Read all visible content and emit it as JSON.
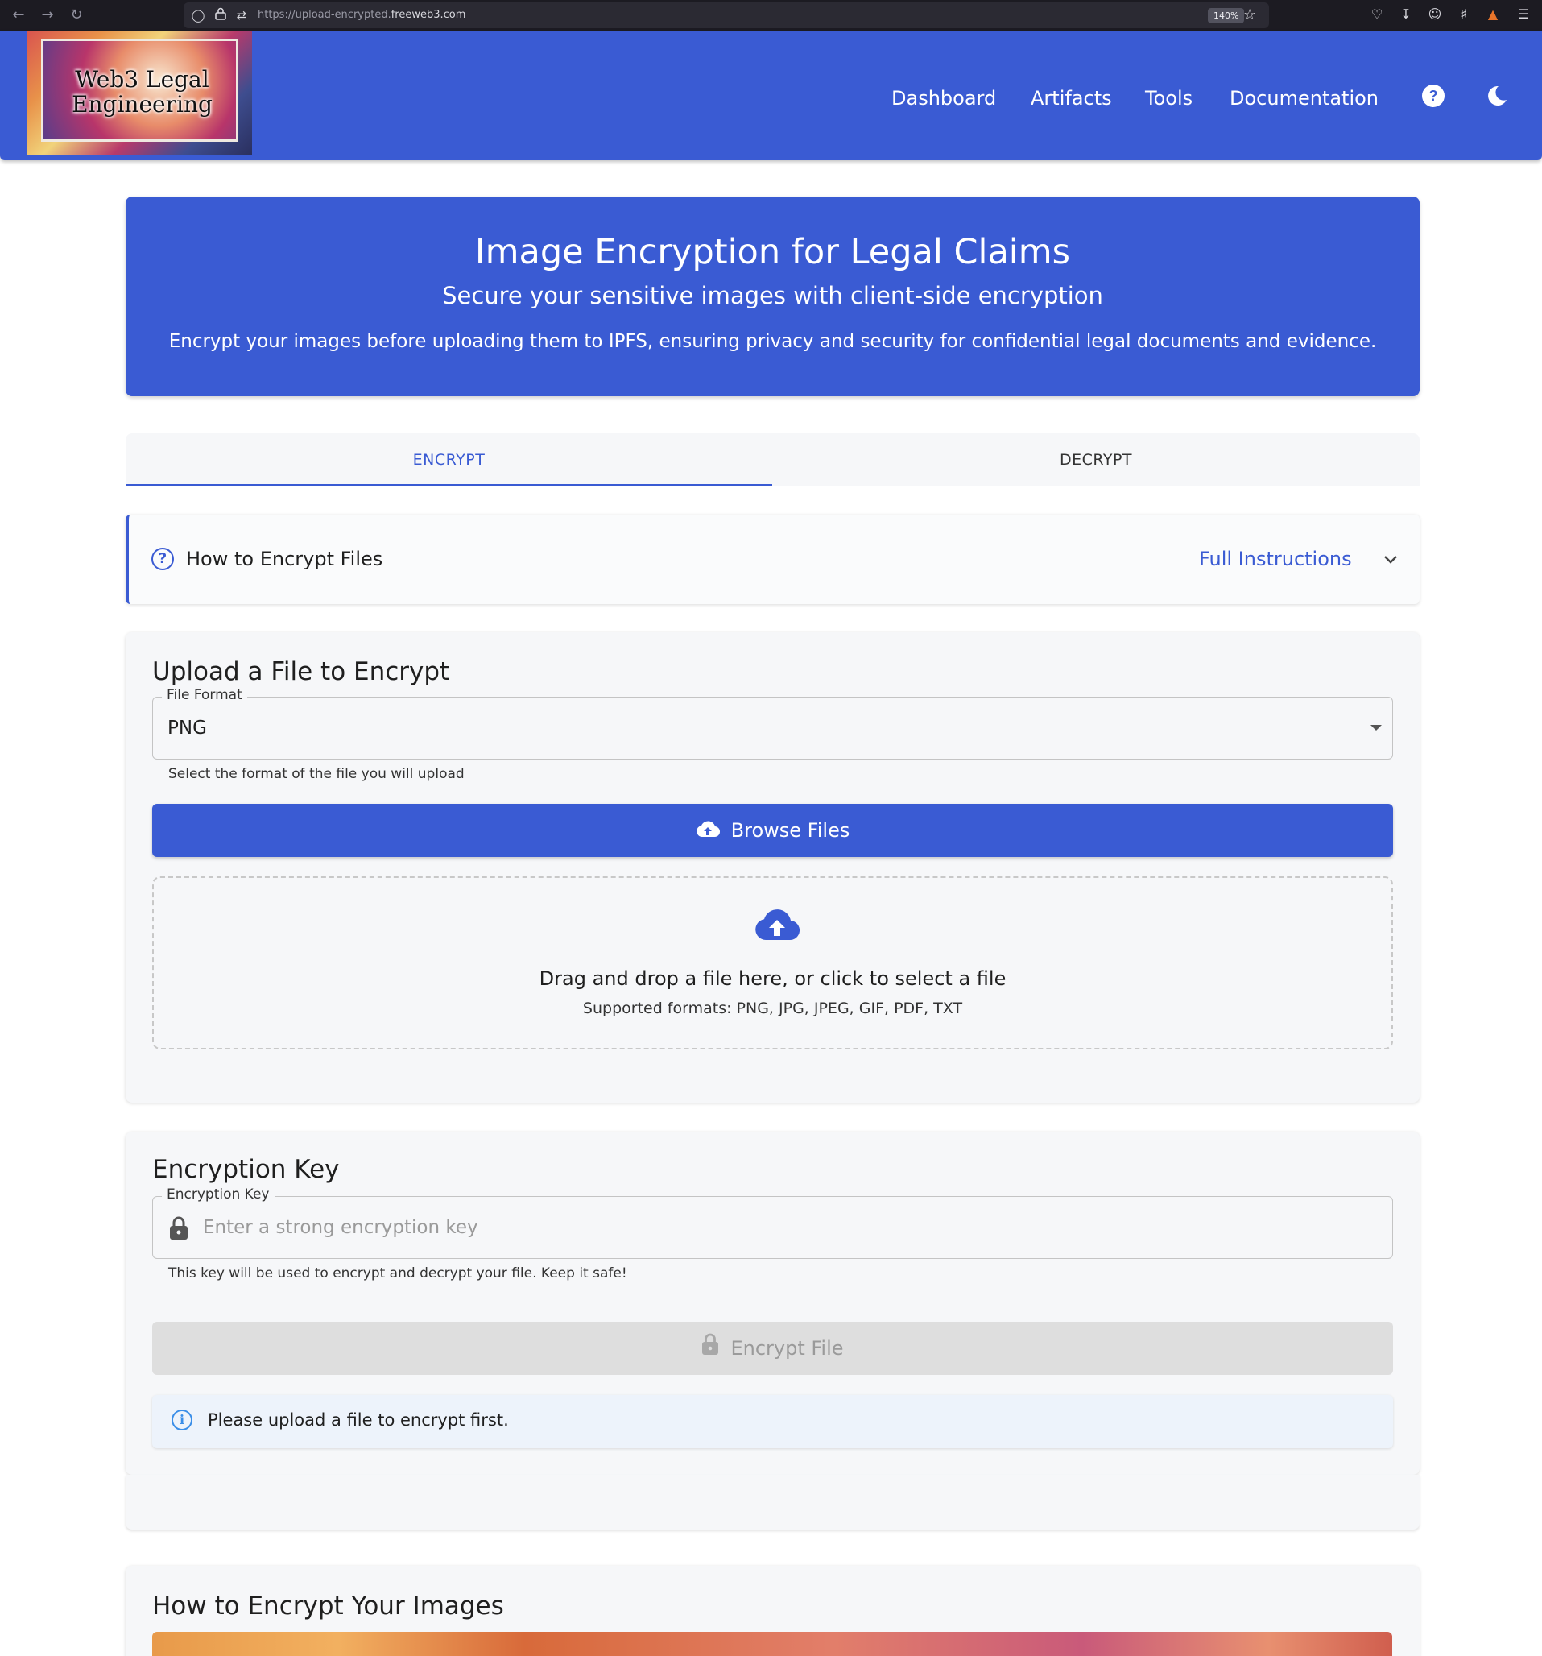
{
  "browser": {
    "url_prefix": "https://upload-encrypted.",
    "url_domain": "freeweb3.com",
    "zoom": "140%"
  },
  "header": {
    "logo_text": "Web3 Legal\nEngineering",
    "nav": [
      "Dashboard",
      "Artifacts",
      "Tools",
      "Documentation"
    ],
    "help_icon": "help-circle-icon",
    "theme_icon": "moon-icon"
  },
  "hero": {
    "title": "Image Encryption for Legal Claims",
    "subtitle": "Secure your sensitive images with client-side encryption",
    "description": "Encrypt your images before uploading them to IPFS, ensuring privacy and security for confidential legal documents and evidence."
  },
  "tabs": [
    {
      "label": "ENCRYPT",
      "active": true
    },
    {
      "label": "DECRYPT",
      "active": false
    }
  ],
  "howto": {
    "title": "How to Encrypt Files",
    "link": "Full Instructions"
  },
  "upload": {
    "title": "Upload a File to Encrypt",
    "format_label": "File Format",
    "format_value": "PNG",
    "format_helper": "Select the format of the file you will upload",
    "browse_label": "Browse Files",
    "dropzone_main": "Drag and drop a file here, or click to select a file",
    "dropzone_sub": "Supported formats: PNG, JPG, JPEG, GIF, PDF, TXT"
  },
  "key": {
    "title": "Encryption Key",
    "label": "Encryption Key",
    "placeholder": "Enter a strong encryption key",
    "helper": "This key will be used to encrypt and decrypt your file. Keep it safe!",
    "encrypt_label": "Encrypt File",
    "alert": "Please upload a file to encrypt first."
  },
  "guide": {
    "title": "How to Encrypt Your Images"
  },
  "colors": {
    "primary": "#3a5bd3",
    "card_bg": "#f6f7f9",
    "info": "#3a8ee8"
  }
}
